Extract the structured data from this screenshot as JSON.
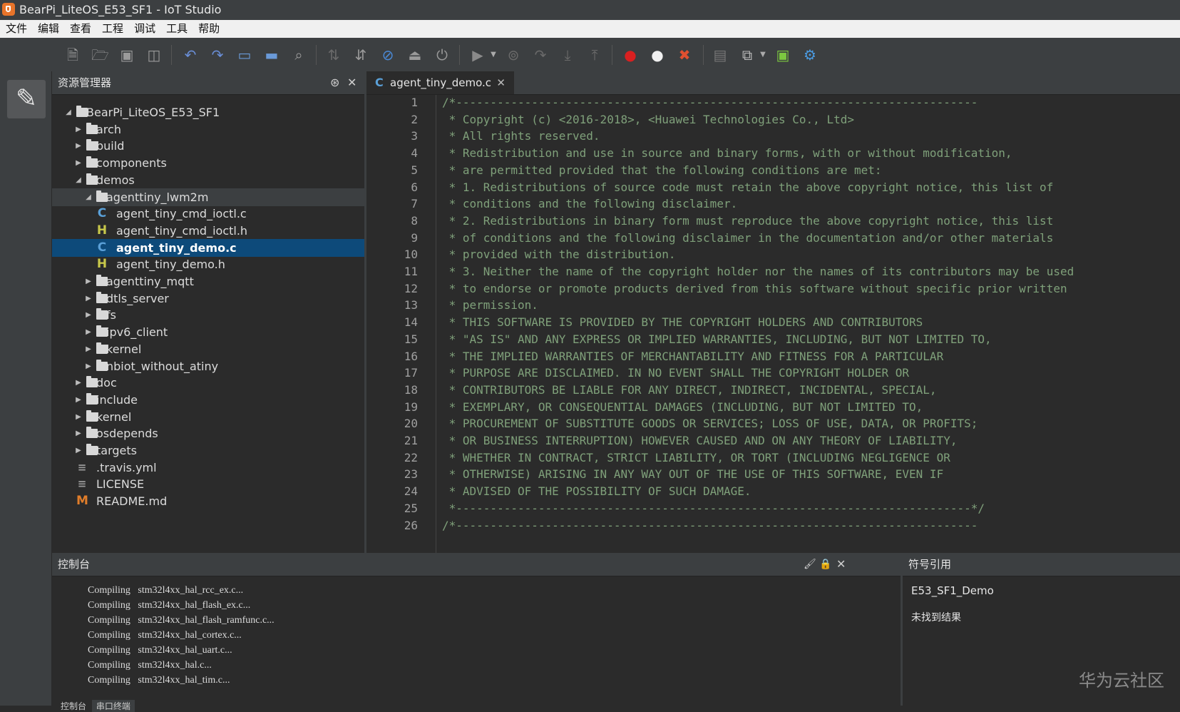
{
  "window": {
    "title": "BearPi_LiteOS_E53_SF1 - IoT Studio"
  },
  "menu": [
    "文件",
    "编辑",
    "查看",
    "工程",
    "调试",
    "工具",
    "帮助"
  ],
  "toolbar_icons": [
    "new-file-icon",
    "open-folder-icon",
    "save-icon",
    "save-all-icon",
    "undo-icon",
    "redo-icon",
    "window-icon",
    "window-alt-icon",
    "search-icon",
    "compile-icon",
    "build-icon",
    "stop-build-icon",
    "download-icon",
    "power-icon",
    "run-icon",
    "debug-stop-icon",
    "step-over-icon",
    "step-into-icon",
    "step-out-icon",
    "record-red-icon",
    "record-white-icon",
    "clear-icon",
    "device-icon",
    "layers-icon",
    "android-icon",
    "settings-icon"
  ],
  "explorer": {
    "title": "资源管理器",
    "tree": [
      {
        "label": "BearPi_LiteOS_E53_SF1",
        "type": "folder",
        "depth": 0,
        "expanded": true
      },
      {
        "label": "arch",
        "type": "folder",
        "depth": 1,
        "expanded": false
      },
      {
        "label": "build",
        "type": "folder",
        "depth": 1,
        "expanded": false
      },
      {
        "label": "components",
        "type": "folder",
        "depth": 1,
        "expanded": false
      },
      {
        "label": "demos",
        "type": "folder",
        "depth": 1,
        "expanded": true
      },
      {
        "label": "agenttiny_lwm2m",
        "type": "folder",
        "depth": 2,
        "expanded": true,
        "state": "sel-parent"
      },
      {
        "label": "agent_tiny_cmd_ioctl.c",
        "type": "c",
        "depth": 3
      },
      {
        "label": "agent_tiny_cmd_ioctl.h",
        "type": "h",
        "depth": 3
      },
      {
        "label": "agent_tiny_demo.c",
        "type": "c",
        "depth": 3,
        "state": "selected"
      },
      {
        "label": "agent_tiny_demo.h",
        "type": "h",
        "depth": 3
      },
      {
        "label": "agenttiny_mqtt",
        "type": "folder",
        "depth": 2,
        "expanded": false
      },
      {
        "label": "dtls_server",
        "type": "folder",
        "depth": 2,
        "expanded": false
      },
      {
        "label": "fs",
        "type": "folder",
        "depth": 2,
        "expanded": false
      },
      {
        "label": "ipv6_client",
        "type": "folder",
        "depth": 2,
        "expanded": false
      },
      {
        "label": "kernel",
        "type": "folder",
        "depth": 2,
        "expanded": false
      },
      {
        "label": "nbiot_without_atiny",
        "type": "folder",
        "depth": 2,
        "expanded": false
      },
      {
        "label": "doc",
        "type": "folder",
        "depth": 1,
        "expanded": false
      },
      {
        "label": "include",
        "type": "folder",
        "depth": 1,
        "expanded": false
      },
      {
        "label": "kernel",
        "type": "folder",
        "depth": 1,
        "expanded": false
      },
      {
        "label": "osdepends",
        "type": "folder",
        "depth": 1,
        "expanded": false
      },
      {
        "label": "targets",
        "type": "folder",
        "depth": 1,
        "expanded": false
      },
      {
        "label": ".travis.yml",
        "type": "txt",
        "depth": 1
      },
      {
        "label": "LICENSE",
        "type": "txt",
        "depth": 1
      },
      {
        "label": "README.md",
        "type": "m",
        "depth": 1
      }
    ]
  },
  "editor": {
    "tab": "agent_tiny_demo.c",
    "lines": [
      "/*----------------------------------------------------------------------------",
      " * Copyright (c) <2016-2018>, <Huawei Technologies Co., Ltd>",
      " * All rights reserved.",
      " * Redistribution and use in source and binary forms, with or without modification,",
      " * are permitted provided that the following conditions are met:",
      " * 1. Redistributions of source code must retain the above copyright notice, this list of",
      " * conditions and the following disclaimer.",
      " * 2. Redistributions in binary form must reproduce the above copyright notice, this list",
      " * of conditions and the following disclaimer in the documentation and/or other materials",
      " * provided with the distribution.",
      " * 3. Neither the name of the copyright holder nor the names of its contributors may be used",
      " * to endorse or promote products derived from this software without specific prior written",
      " * permission.",
      " * THIS SOFTWARE IS PROVIDED BY THE COPYRIGHT HOLDERS AND CONTRIBUTORS",
      " * \"AS IS\" AND ANY EXPRESS OR IMPLIED WARRANTIES, INCLUDING, BUT NOT LIMITED TO,",
      " * THE IMPLIED WARRANTIES OF MERCHANTABILITY AND FITNESS FOR A PARTICULAR",
      " * PURPOSE ARE DISCLAIMED. IN NO EVENT SHALL THE COPYRIGHT HOLDER OR",
      " * CONTRIBUTORS BE LIABLE FOR ANY DIRECT, INDIRECT, INCIDENTAL, SPECIAL,",
      " * EXEMPLARY, OR CONSEQUENTIAL DAMAGES (INCLUDING, BUT NOT LIMITED TO,",
      " * PROCUREMENT OF SUBSTITUTE GOODS OR SERVICES; LOSS OF USE, DATA, OR PROFITS;",
      " * OR BUSINESS INTERRUPTION) HOWEVER CAUSED AND ON ANY THEORY OF LIABILITY,",
      " * WHETHER IN CONTRACT, STRICT LIABILITY, OR TORT (INCLUDING NEGLIGENCE OR",
      " * OTHERWISE) ARISING IN ANY WAY OUT OF THE USE OF THIS SOFTWARE, EVEN IF",
      " * ADVISED OF THE POSSIBILITY OF SUCH DAMAGE.",
      " *---------------------------------------------------------------------------*/",
      "/*----------------------------------------------------------------------------"
    ]
  },
  "console": {
    "title": "控制台",
    "lines": [
      "Compiling   stm32l4xx_hal_rcc_ex.c...",
      "Compiling   stm32l4xx_hal_flash_ex.c...",
      "Compiling   stm32l4xx_hal_flash_ramfunc.c...",
      "Compiling   stm32l4xx_hal_cortex.c...",
      "Compiling   stm32l4xx_hal_uart.c...",
      "Compiling   stm32l4xx_hal.c...",
      "Compiling   stm32l4xx_hal_tim.c..."
    ],
    "bottom_tabs": [
      "控制台",
      "串口终端"
    ]
  },
  "symbols": {
    "title": "符号引用",
    "project": "E53_SF1_Demo",
    "result": "未找到结果"
  },
  "watermark": "华为云社区",
  "colors": {
    "selected": "#0d4a7a",
    "comment": "#7fa07a",
    "c_icon": "#5aa0d8",
    "h_icon": "#c8c84a",
    "md_icon": "#e07d2a"
  }
}
